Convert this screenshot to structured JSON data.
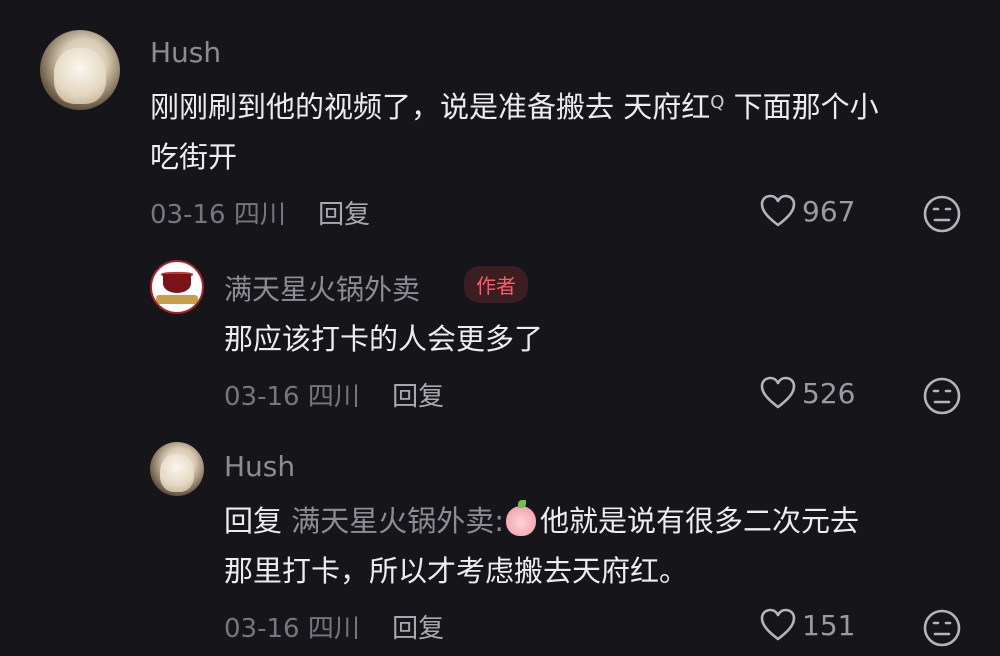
{
  "comments": [
    {
      "username": "Hush",
      "text_main": "刚刚刷到他的视频了，说是准备搬去 天府红",
      "search_hint": "Q",
      "text_tail": " 下面那个小",
      "text_line2": "吃街开",
      "date": "03-16",
      "location": "四川",
      "reply_label": "回复",
      "likes": "967"
    },
    {
      "username": "满天星火锅外卖",
      "author_badge": "作者",
      "text": "那应该打卡的人会更多了",
      "date": "03-16",
      "location": "四川",
      "reply_label": "回复",
      "likes": "526"
    },
    {
      "username": "Hush",
      "reply_prefix": "回复",
      "reply_target": "满天星火锅外卖:",
      "text_line1": "他就是说有很多二次元去",
      "text_line2": "那里打卡，所以才考虑搬去天府红。",
      "date": "03-16",
      "location": "四川",
      "reply_label": "回复",
      "likes": "151"
    }
  ]
}
